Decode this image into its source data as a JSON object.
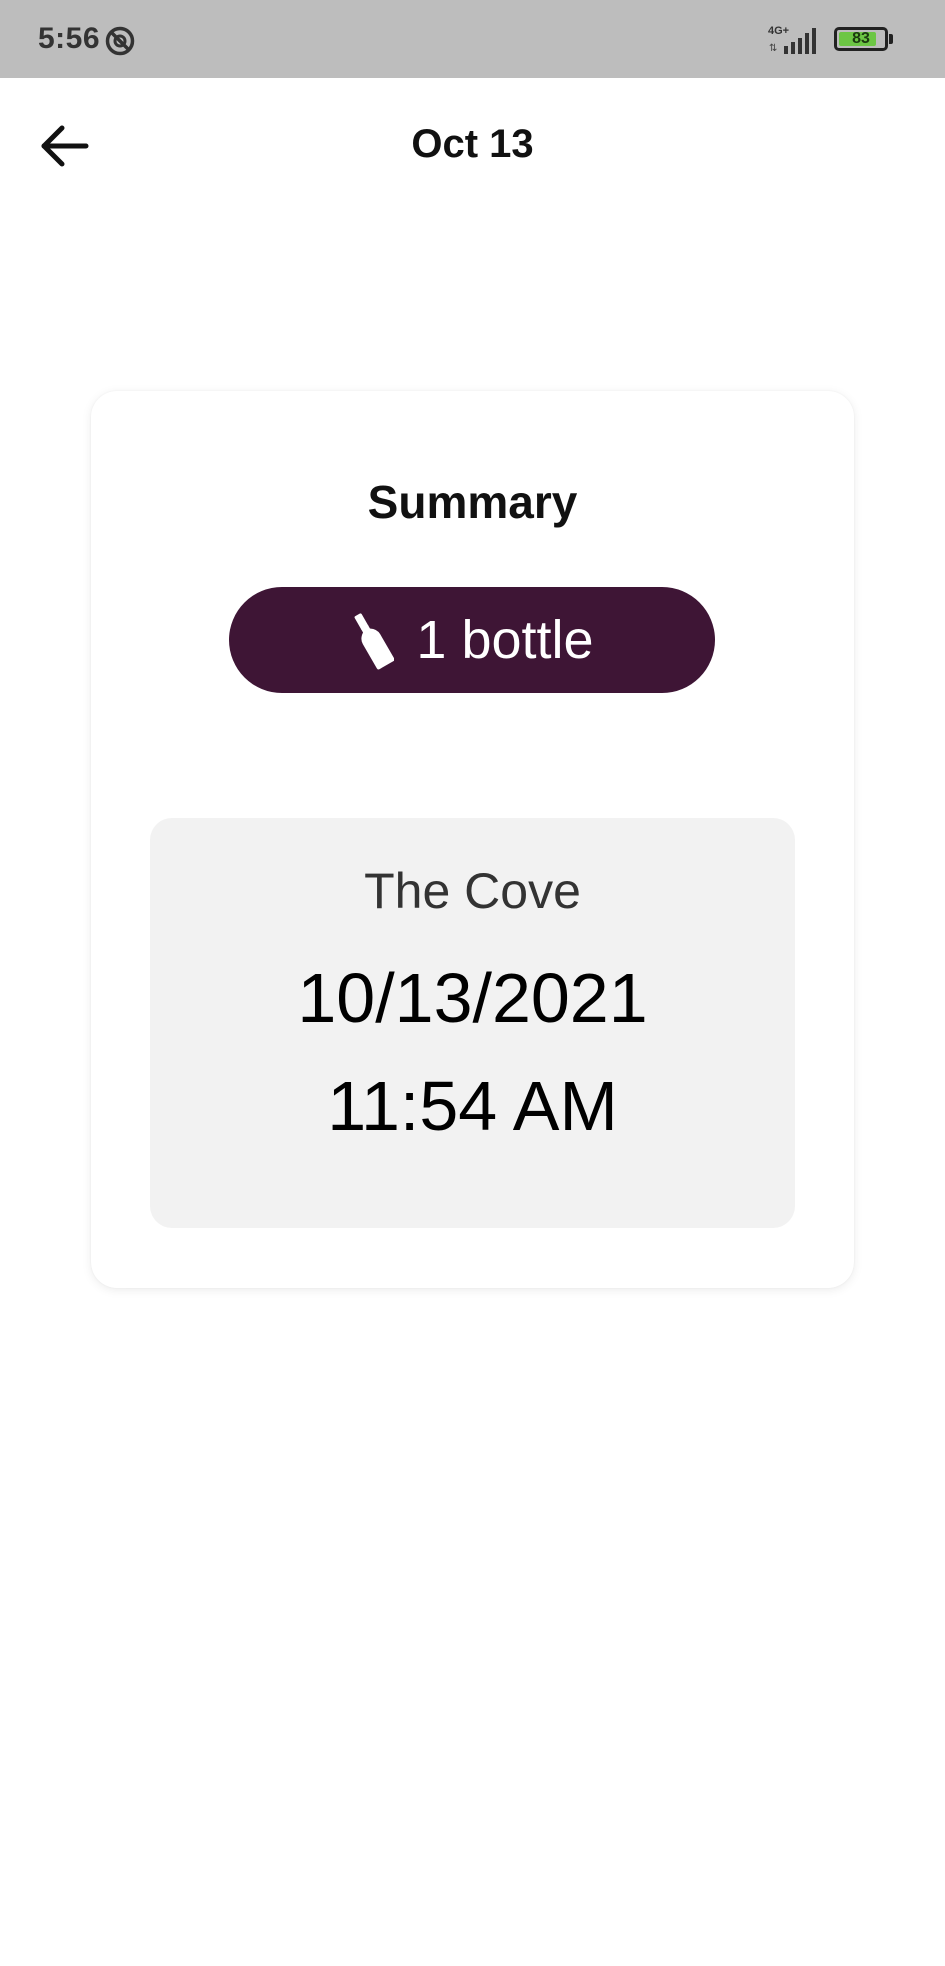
{
  "status_bar": {
    "time": "5:56",
    "network_label": "4G+",
    "battery_level": "83",
    "battery_fraction": 0.83,
    "battery_color": "#6cc644",
    "icons": [
      "do-not-disturb-icon",
      "signal-icon",
      "battery-icon"
    ]
  },
  "header": {
    "back_icon": "arrow-left-icon",
    "title": "Oct 13"
  },
  "summary": {
    "title": "Summary",
    "bottle_icon": "wine-bottle-icon",
    "bottle_count_label": "1 bottle",
    "pill_color": "#3e1535"
  },
  "visit": {
    "place": "The Cove",
    "date": "10/13/2021",
    "time": "11:54 AM"
  }
}
